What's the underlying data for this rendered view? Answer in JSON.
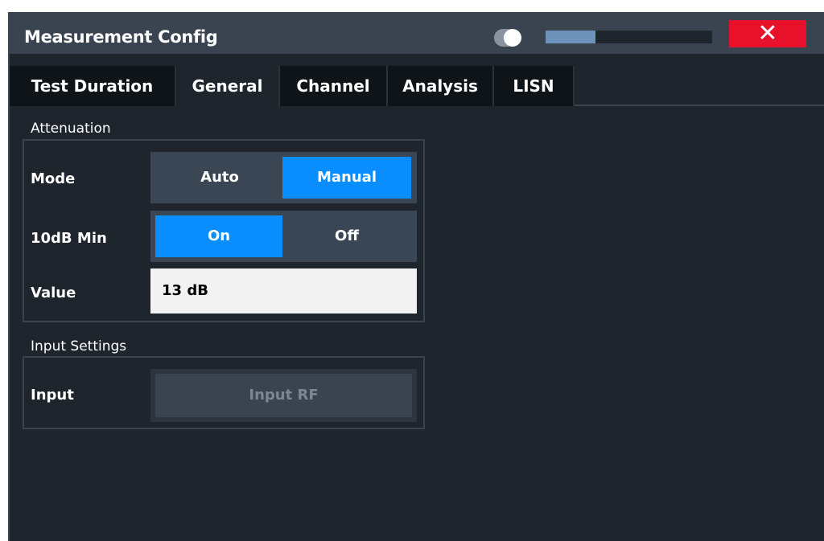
{
  "window": {
    "title": "Measurement Config",
    "close_label": "✕",
    "transparency_level": 0.3
  },
  "tabs": [
    {
      "label": "Test Duration",
      "active": false
    },
    {
      "label": "General",
      "active": true
    },
    {
      "label": "Channel",
      "active": false
    },
    {
      "label": "Analysis",
      "active": false
    },
    {
      "label": "LISN",
      "active": false
    }
  ],
  "attenuation": {
    "section_label": "Attenuation",
    "mode": {
      "label": "Mode",
      "options": [
        "Auto",
        "Manual"
      ],
      "selected": "Manual"
    },
    "min10db": {
      "label": "10dB Min",
      "options": [
        "On",
        "Off"
      ],
      "selected": "On"
    },
    "value": {
      "label": "Value",
      "value": "13 dB"
    }
  },
  "input_settings": {
    "section_label": "Input Settings",
    "input": {
      "label": "Input",
      "value": "Input RF",
      "enabled": false
    }
  },
  "colors": {
    "background": "#1f252d",
    "titlebar": "#3a4451",
    "accent": "#0a8dff",
    "close": "#e8112b"
  }
}
